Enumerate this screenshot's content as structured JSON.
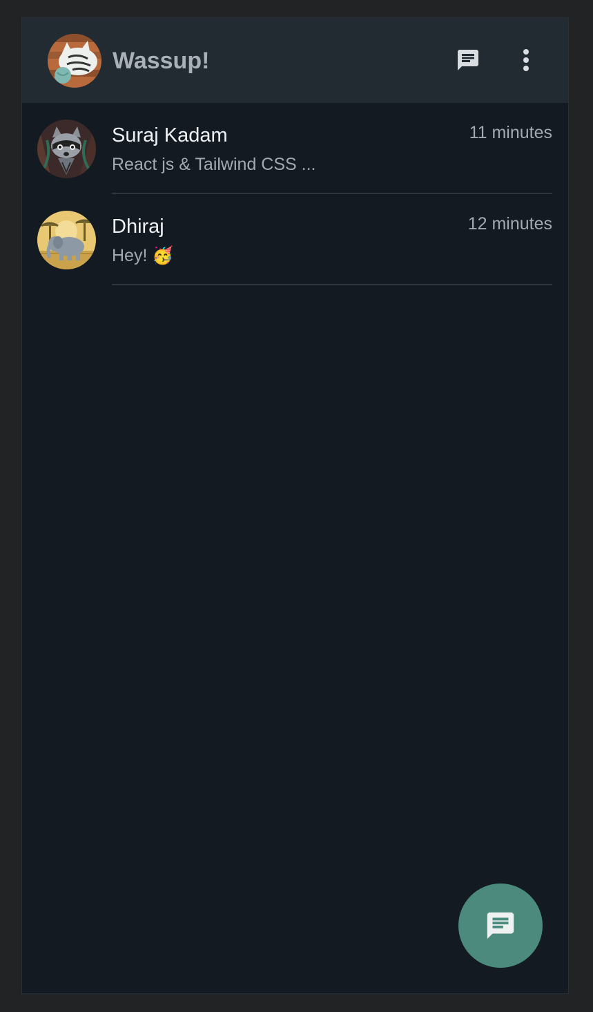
{
  "header": {
    "title": "Wassup!",
    "avatar_icon": "user-avatar-cat",
    "new_chat_icon": "chat-icon",
    "menu_icon": "more-vert-icon"
  },
  "chats": [
    {
      "name": "Suraj Kadam",
      "preview": "React js & Tailwind CSS ...",
      "time": "11 minutes",
      "avatar_icon": "avatar-raccoon"
    },
    {
      "name": "Dhiraj",
      "preview": "Hey! 🥳",
      "time": "12 minutes",
      "avatar_icon": "avatar-elephant"
    }
  ],
  "fab": {
    "icon": "chat-icon"
  },
  "colors": {
    "background": "#141a21",
    "header": "#222a32",
    "accent": "#4b8a7d",
    "muted_text": "#a3a9b0"
  }
}
